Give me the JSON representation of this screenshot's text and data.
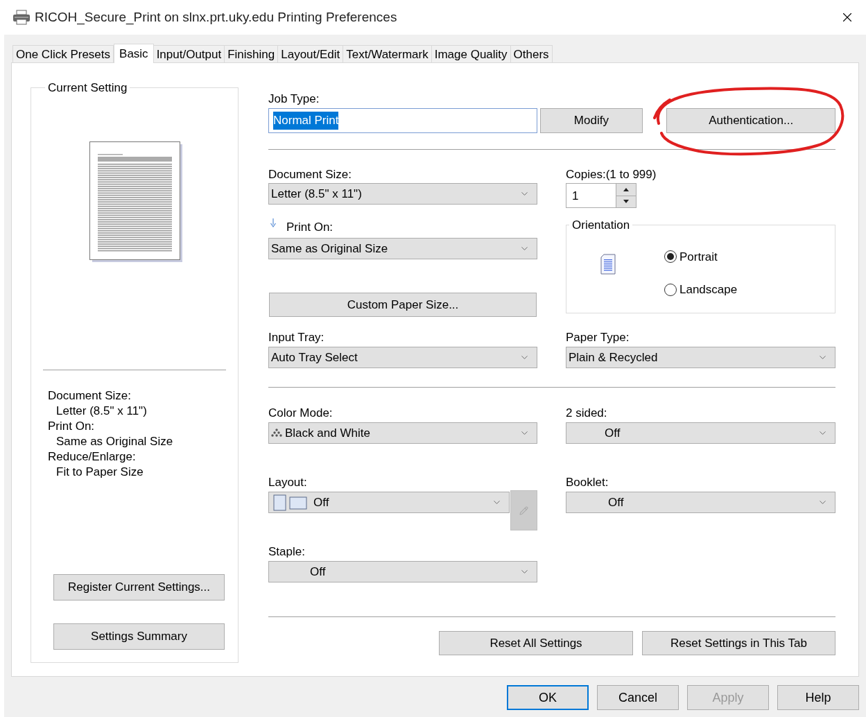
{
  "window": {
    "title": "RICOH_Secure_Print on slnx.prt.uky.edu Printing Preferences"
  },
  "tabs": [
    {
      "label": "One Click Presets",
      "selected": false
    },
    {
      "label": "Basic",
      "selected": true
    },
    {
      "label": "Input/Output",
      "selected": false
    },
    {
      "label": "Finishing",
      "selected": false
    },
    {
      "label": "Layout/Edit",
      "selected": false
    },
    {
      "label": "Text/Watermark",
      "selected": false
    },
    {
      "label": "Image Quality",
      "selected": false
    },
    {
      "label": "Others",
      "selected": false
    }
  ],
  "current_setting": {
    "title": "Current Setting",
    "summary": [
      {
        "label": "Document Size:",
        "value": "Letter (8.5\" x 11\")"
      },
      {
        "label": "Print On:",
        "value": "Same as Original Size"
      },
      {
        "label": "Reduce/Enlarge:",
        "value": "Fit to Paper Size"
      }
    ],
    "buttons": [
      "Register Current Settings...",
      "Settings Summary"
    ]
  },
  "job_type": {
    "label": "Job Type:",
    "value": "Normal Print",
    "value_selected": true,
    "buttons": [
      "Modify",
      "Authentication..."
    ]
  },
  "document_size": {
    "label": "Document Size:",
    "value": "Letter (8.5\" x 11\")"
  },
  "copies": {
    "label": "Copies:(1 to 999)",
    "value": "1"
  },
  "print_on": {
    "label": "Print On:",
    "value": "Same as Original Size"
  },
  "custom_paper_button": "Custom Paper Size...",
  "orientation": {
    "title": "Orientation",
    "options": [
      {
        "label": "Portrait",
        "selected": true
      },
      {
        "label": "Landscape",
        "selected": false
      }
    ]
  },
  "input_tray": {
    "label": "Input Tray:",
    "value": "Auto Tray Select"
  },
  "paper_type": {
    "label": "Paper Type:",
    "value": "Plain & Recycled"
  },
  "color_mode": {
    "label": "Color Mode:",
    "value": "Black and White"
  },
  "two_sided": {
    "label": "2 sided:",
    "value": "Off"
  },
  "layout": {
    "label": "Layout:",
    "value": "Off",
    "edit_disabled": true
  },
  "booklet": {
    "label": "Booklet:",
    "value": "Off"
  },
  "staple": {
    "label": "Staple:",
    "value": "Off"
  },
  "reset_buttons": [
    "Reset All Settings",
    "Reset Settings in This Tab"
  ],
  "dialog_buttons": [
    {
      "label": "OK",
      "default": true,
      "disabled": false
    },
    {
      "label": "Cancel",
      "default": false,
      "disabled": false
    },
    {
      "label": "Apply",
      "default": false,
      "disabled": true
    },
    {
      "label": "Help",
      "default": false,
      "disabled": false
    }
  ]
}
